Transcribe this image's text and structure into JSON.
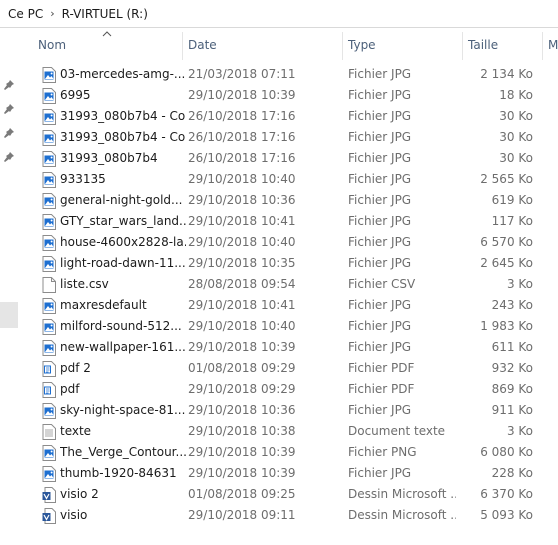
{
  "breadcrumb": {
    "root": "Ce PC",
    "separator": "›",
    "drive": "R-VIRTUEL (R:)"
  },
  "columns": {
    "name": "Nom",
    "date": "Date",
    "type": "Type",
    "size": "Taille",
    "more": "M"
  },
  "files": [
    {
      "name": "03-mercedes-amg-...",
      "date": "21/03/2018 07:11",
      "type": "Fichier JPG",
      "size": "2 134 Ko",
      "icon": "image-file-icon"
    },
    {
      "name": "6995",
      "date": "29/10/2018 10:39",
      "type": "Fichier JPG",
      "size": "18 Ko",
      "icon": "image-file-icon"
    },
    {
      "name": "31993_080b7b4 - Co...",
      "date": "26/10/2018 17:16",
      "type": "Fichier JPG",
      "size": "30 Ko",
      "icon": "image-file-icon"
    },
    {
      "name": "31993_080b7b4 - Co",
      "date": "26/10/2018 17:16",
      "type": "Fichier JPG",
      "size": "30 Ko",
      "icon": "image-file-icon"
    },
    {
      "name": "31993_080b7b4",
      "date": "26/10/2018 17:16",
      "type": "Fichier JPG",
      "size": "30 Ko",
      "icon": "image-file-icon"
    },
    {
      "name": "933135",
      "date": "29/10/2018 10:40",
      "type": "Fichier JPG",
      "size": "2 565 Ko",
      "icon": "image-file-icon"
    },
    {
      "name": "general-night-gold...",
      "date": "29/10/2018 10:36",
      "type": "Fichier JPG",
      "size": "619 Ko",
      "icon": "image-file-icon"
    },
    {
      "name": "GTY_star_wars_land...",
      "date": "29/10/2018 10:41",
      "type": "Fichier JPG",
      "size": "117 Ko",
      "icon": "image-file-icon"
    },
    {
      "name": "house-4600x2828-la...",
      "date": "29/10/2018 10:40",
      "type": "Fichier JPG",
      "size": "6 570 Ko",
      "icon": "image-file-icon"
    },
    {
      "name": "light-road-dawn-11...",
      "date": "29/10/2018 10:35",
      "type": "Fichier JPG",
      "size": "2 645 Ko",
      "icon": "image-file-icon"
    },
    {
      "name": "liste.csv",
      "date": "28/08/2018 09:54",
      "type": "Fichier CSV",
      "size": "3 Ko",
      "icon": "blank-file-icon"
    },
    {
      "name": "maxresdefault",
      "date": "29/10/2018 10:41",
      "type": "Fichier JPG",
      "size": "243 Ko",
      "icon": "image-file-icon"
    },
    {
      "name": "milford-sound-512...",
      "date": "29/10/2018 10:40",
      "type": "Fichier JPG",
      "size": "1 983 Ko",
      "icon": "image-file-icon"
    },
    {
      "name": "new-wallpaper-161...",
      "date": "29/10/2018 10:39",
      "type": "Fichier JPG",
      "size": "611 Ko",
      "icon": "image-file-icon"
    },
    {
      "name": "pdf 2",
      "date": "01/08/2018 09:29",
      "type": "Fichier PDF",
      "size": "932 Ko",
      "icon": "pdf-file-icon"
    },
    {
      "name": "pdf",
      "date": "29/10/2018 09:29",
      "type": "Fichier PDF",
      "size": "869 Ko",
      "icon": "pdf-file-icon"
    },
    {
      "name": "sky-night-space-81...",
      "date": "29/10/2018 10:36",
      "type": "Fichier JPG",
      "size": "911 Ko",
      "icon": "image-file-icon"
    },
    {
      "name": "texte",
      "date": "29/10/2018 10:38",
      "type": "Document texte",
      "size": "3 Ko",
      "icon": "text-file-icon"
    },
    {
      "name": "The_Verge_Contour...",
      "date": "29/10/2018 10:39",
      "type": "Fichier PNG",
      "size": "6 080 Ko",
      "icon": "image-file-icon"
    },
    {
      "name": "thumb-1920-84631",
      "date": "29/10/2018 10:39",
      "type": "Fichier JPG",
      "size": "228 Ko",
      "icon": "image-file-icon"
    },
    {
      "name": "visio 2",
      "date": "01/08/2018 09:25",
      "type": "Dessin Microsoft ...",
      "size": "6 370 Ko",
      "icon": "visio-file-icon"
    },
    {
      "name": "visio",
      "date": "29/10/2018 09:11",
      "type": "Dessin Microsoft ...",
      "size": "5 093 Ko",
      "icon": "visio-file-icon"
    }
  ]
}
